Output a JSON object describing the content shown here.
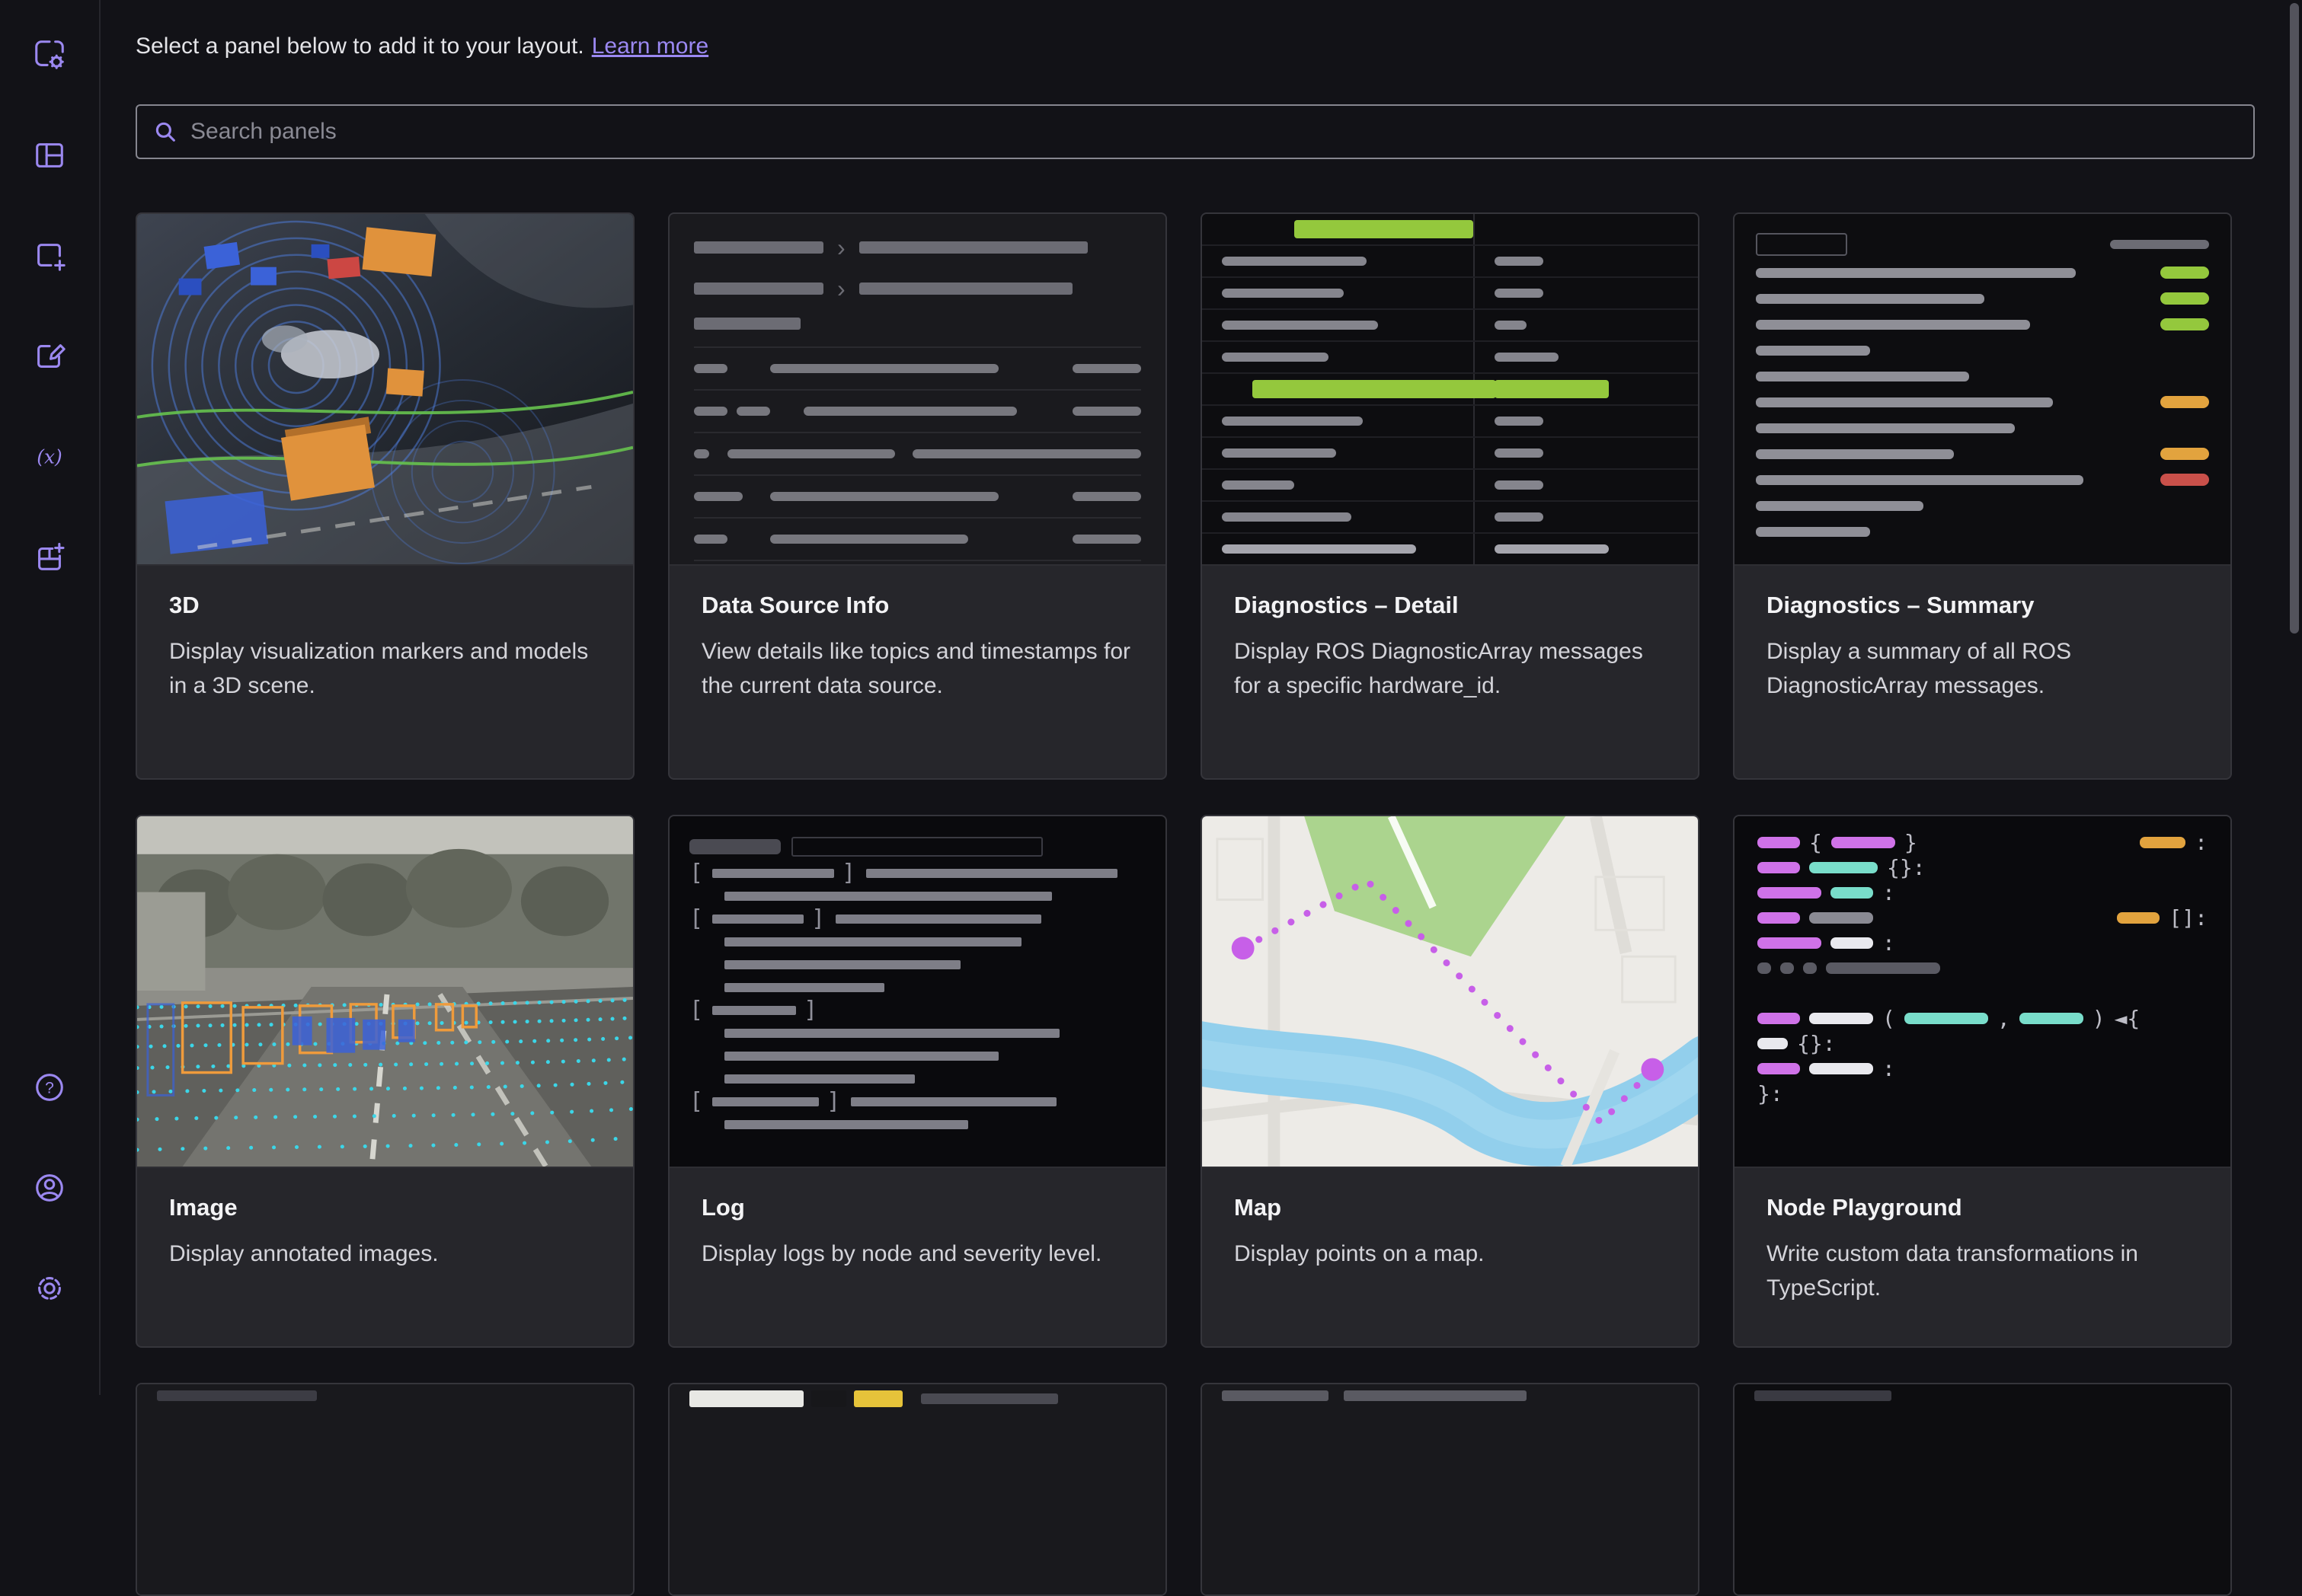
{
  "header": {
    "prompt": "Select a panel below to add it to your layout.",
    "learn_more_label": "Learn more"
  },
  "search": {
    "placeholder": "Search panels"
  },
  "sidebar": {
    "top_icons": [
      "data-source-settings-icon",
      "layouts-icon",
      "add-panel-icon",
      "edit-layout-icon",
      "variables-icon",
      "extensions-icon"
    ],
    "bottom_icons": [
      "help-icon",
      "account-icon",
      "settings-icon"
    ]
  },
  "panels": [
    {
      "title": "3D",
      "description": "Display visualization markers and models in a 3D scene."
    },
    {
      "title": "Data Source Info",
      "description": "View details like topics and timestamps for the current data source."
    },
    {
      "title": "Diagnostics – Detail",
      "description": "Display ROS DiagnosticArray messages for a specific hardware_id."
    },
    {
      "title": "Diagnostics – Summary",
      "description": "Display a summary of all ROS DiagnosticArray messages."
    },
    {
      "title": "Image",
      "description": "Display annotated images."
    },
    {
      "title": "Log",
      "description": "Display logs by node and severity level."
    },
    {
      "title": "Map",
      "description": "Display points on a map."
    },
    {
      "title": "Node Playground",
      "description": "Write custom data transformations in TypeScript."
    }
  ],
  "colors": {
    "accent_purple": "#9b88f0",
    "success_green": "#94c83d",
    "warning_orange": "#e2a33e",
    "error_red": "#c9504a",
    "route_purple": "#c75fe8"
  }
}
